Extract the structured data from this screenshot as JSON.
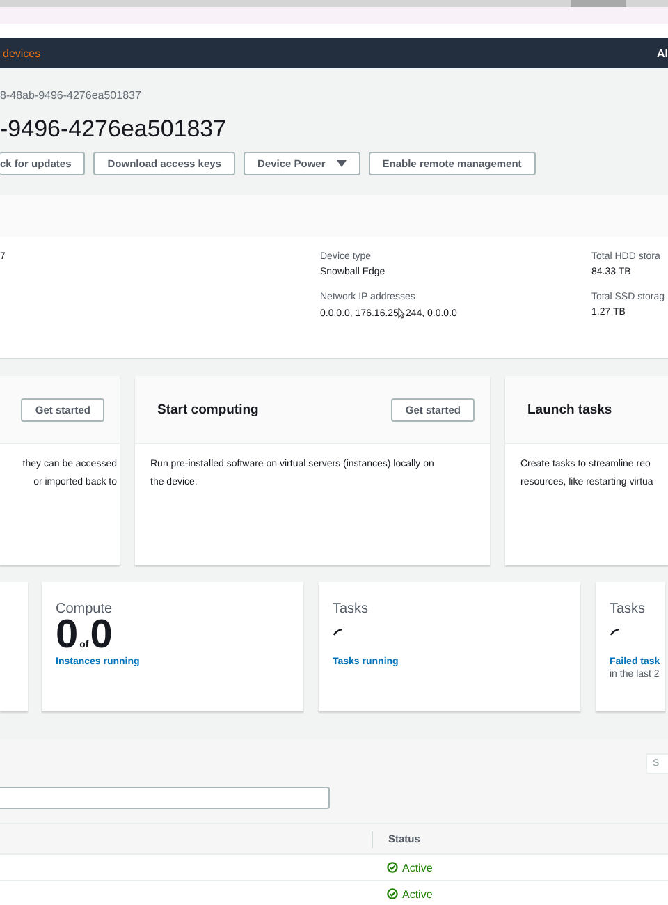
{
  "nav": {
    "section": "devices",
    "right": "Al"
  },
  "header": {
    "breadcrumb": "8-48ab-9496-4276ea501837",
    "title": "-9496-4276ea501837",
    "buttons": [
      {
        "label": "ck for updates",
        "kind": "plain"
      },
      {
        "label": "Download access keys",
        "kind": "plain"
      },
      {
        "label": "Device Power",
        "kind": "dropdown"
      },
      {
        "label": "Enable remote management",
        "kind": "plain"
      }
    ]
  },
  "details": {
    "columns": [
      [
        {
          "value": "7"
        }
      ],
      [
        {
          "label": "Device type",
          "value": "Snowball Edge"
        },
        {
          "label": "Network IP addresses",
          "value_parts": [
            "0.0.0.0, 176.16.25",
            "244, 0.0.0.0"
          ]
        }
      ],
      [
        {
          "label": "Total HDD stora",
          "value": "84.33 TB"
        },
        {
          "label": "Total SSD storag",
          "value": "1.27 TB"
        }
      ]
    ]
  },
  "cards": [
    {
      "button": "Get started",
      "lines": [
        "they can be accessed",
        "or imported back to"
      ]
    },
    {
      "title": "Start computing",
      "button": "Get started",
      "lines": [
        "Run pre-installed software on virtual servers (instances) locally on",
        "the device."
      ]
    },
    {
      "title": "Launch tasks",
      "lines": [
        "Create tasks to streamline reo",
        "resources, like restarting virtua"
      ]
    }
  ],
  "stats": [
    {
      "kind": "count",
      "title": "Compute",
      "count": "0",
      "of": "of",
      "total": "0",
      "link": "Instances running"
    },
    {
      "kind": "loading",
      "title": "Tasks",
      "link": "Tasks running"
    },
    {
      "kind": "loading",
      "title": "Tasks",
      "link": "Failed task",
      "note": "in the last 2"
    }
  ],
  "table": {
    "button": "S",
    "columns": [
      {
        "label": "Status"
      }
    ],
    "rows": [
      {
        "status": "Active"
      },
      {
        "status": "Active"
      }
    ]
  }
}
